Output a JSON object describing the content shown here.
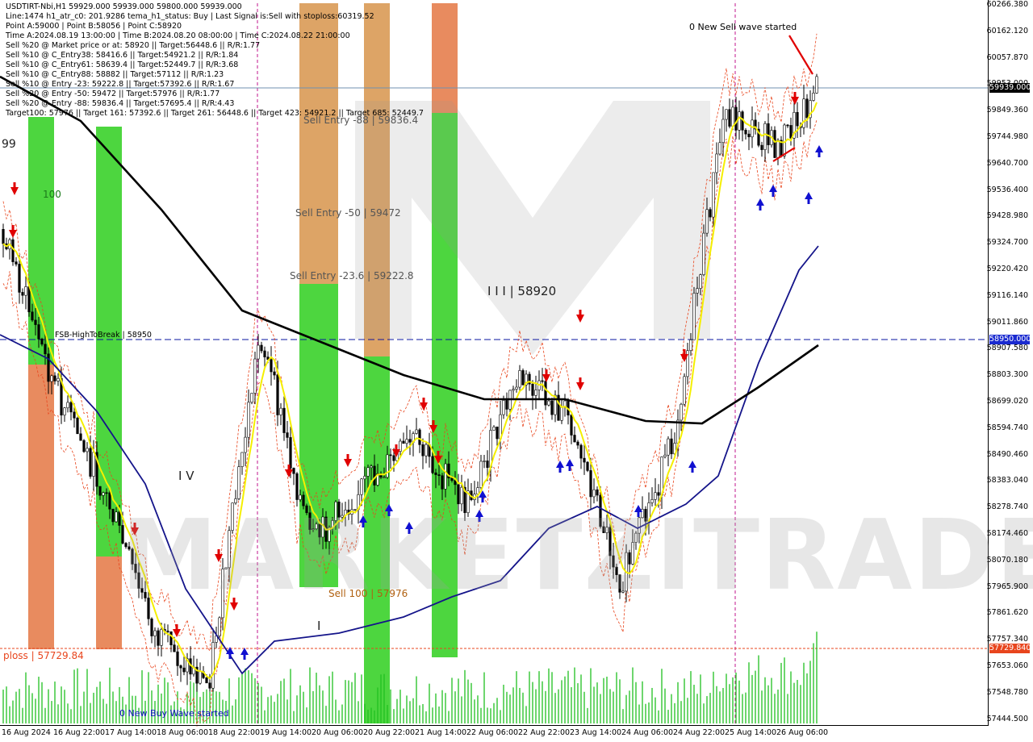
{
  "header": {
    "lines": [
      "USDTIRT-Nbi,H1  59929.000 59939.000 59800.000 59939.000",
      "Line:1474  h1_atr_c0: 201.9286  tema_h1_status: Buy  | Last Signal is:Sell with stoploss:60319.52",
      "Point A:59000 | Point B:58056 | Point C:58920",
      "Time A:2024.08.19 13:00:00 | Time B:2024.08.20 08:00:00 | Time C:2024.08.22 21:00:00",
      "Sell %20 @ Market price or at: 58920 || Target:56448.6 || R/R:1.77",
      "Sell %10 @ C_Entry38: 58416.6 || Target:54921.2 || R/R:1.84",
      "Sell %10 @ C_Entry61: 58639.4 || Target:52449.7 || R/R:3.68",
      "Sell %10 @ C_Entry88: 58882 || Target:57112 || R/R:1.23",
      "Sell %10 @ Entry -23: 59222.8 || Target:57392.6 || R/R:1.67",
      "Sell %20 @ Entry -50: 59472 || Target:57976 || R/R:1.77",
      "Sell %20 @ Entry -88: 59836.4 || Target:57695.4 || R/R:4.43",
      "Target100: 57976 || Target 161: 57392.6 || Target 261: 56448.6 || Target 423: 54921.2 || Target 685: 52449.7"
    ]
  },
  "labels": {
    "sell_entry_88": "Sell Entry -88 | 59836.4",
    "sell_entry_50": "Sell Entry -50 | 59472",
    "sell_entry_23": "Sell Entry -23.6 | 59222.8",
    "sell_100": "Sell 100 | 57976",
    "point_c": "I I I | 58920",
    "wave_iv": "I V",
    "wave_i": "I",
    "fsb": "FSB-HighToBreak  |  58950",
    "stoploss": "ploss | 57729.84",
    "new_sell_wave": "0 New Sell wave started",
    "new_buy_wave": "0 New Buy Wave started",
    "val_100": "100",
    "val_99": "99",
    "watermark": "MARKETZITRADE"
  },
  "price_axis": {
    "ticks": [
      "60266.380",
      "60162.120",
      "60057.870",
      "59953.000",
      "59849.360",
      "59744.980",
      "59640.700",
      "59536.400",
      "59428.980",
      "59324.700",
      "59220.420",
      "59116.140",
      "59011.860",
      "58907.580",
      "58803.300",
      "58699.020",
      "58594.740",
      "58490.460",
      "58383.040",
      "58278.740",
      "58174.460",
      "58070.180",
      "57965.900",
      "57861.620",
      "57757.340",
      "57653.060",
      "57548.780",
      "57444.500"
    ],
    "current_price": "59939.000",
    "fsb_price": "58950.000",
    "stoploss_price": "57729.840"
  },
  "time_axis": {
    "ticks": [
      "16 Aug 2024",
      "16 Aug 22:00",
      "17 Aug 14:00",
      "18 Aug 06:00",
      "18 Aug 22:00",
      "19 Aug 14:00",
      "20 Aug 06:00",
      "20 Aug 22:00",
      "21 Aug 14:00",
      "22 Aug 06:00",
      "22 Aug 22:00",
      "23 Aug 14:00",
      "24 Aug 06:00",
      "24 Aug 22:00",
      "25 Aug 14:00",
      "26 Aug 06:00"
    ]
  },
  "colors": {
    "background": "#ffffff",
    "bar_green": "#3ad12a",
    "bar_orange": "#e57e4e",
    "bar_tan": "#d99a55",
    "candle": "#000000",
    "ema_black": "#000000",
    "ma_yellow": "#f5ef00",
    "ma_navy": "#14148a",
    "envelope_red": "#e8451d",
    "stoploss_line": "#e8451d",
    "fsb_line": "#0a14a0",
    "volume": "#21c021",
    "sell_arrow": "#e00000",
    "buy_arrow": "#1010d0"
  },
  "chart_data": {
    "type": "candlestick",
    "symbol": "USDTIRT-Nbi",
    "timeframe": "H1",
    "ohlc_last": {
      "open": 59929,
      "high": 59939,
      "low": 59800,
      "close": 59939
    },
    "ylim": [
      57444.5,
      60266.38
    ],
    "levels": [
      {
        "name": "Sell Entry -88",
        "value": 59836.4
      },
      {
        "name": "Sell Entry -50",
        "value": 59472
      },
      {
        "name": "Sell Entry -23.6",
        "value": 59222.8
      },
      {
        "name": "FSB-HighToBreak",
        "value": 58950
      },
      {
        "name": "Point C",
        "value": 58920
      },
      {
        "name": "Sell 100",
        "value": 57976
      },
      {
        "name": "Stoploss",
        "value": 57729.84
      }
    ],
    "close_path": [
      [
        "16 Aug 2024",
        59400
      ],
      [
        "16 Aug 22:00",
        58780
      ],
      [
        "17 Aug 14:00",
        58350
      ],
      [
        "18 Aug 06:00",
        57780
      ],
      [
        "18 Aug 22:00",
        57600
      ],
      [
        "19 Aug 14:00",
        58980
      ],
      [
        "20 Aug 06:00",
        58150
      ],
      [
        "20 Aug 22:00",
        58380
      ],
      [
        "21 Aug 14:00",
        58550
      ],
      [
        "22 Aug 06:00",
        58300
      ],
      [
        "22 Aug 22:00",
        58800
      ],
      [
        "23 Aug 14:00",
        58650
      ],
      [
        "24 Aug 06:00",
        58000
      ],
      [
        "24 Aug 22:00",
        58550
      ],
      [
        "25 Aug 14:00",
        59850
      ],
      [
        "26 Aug 06:00",
        59700
      ],
      [
        "26 Aug 13:00",
        59939
      ]
    ]
  }
}
